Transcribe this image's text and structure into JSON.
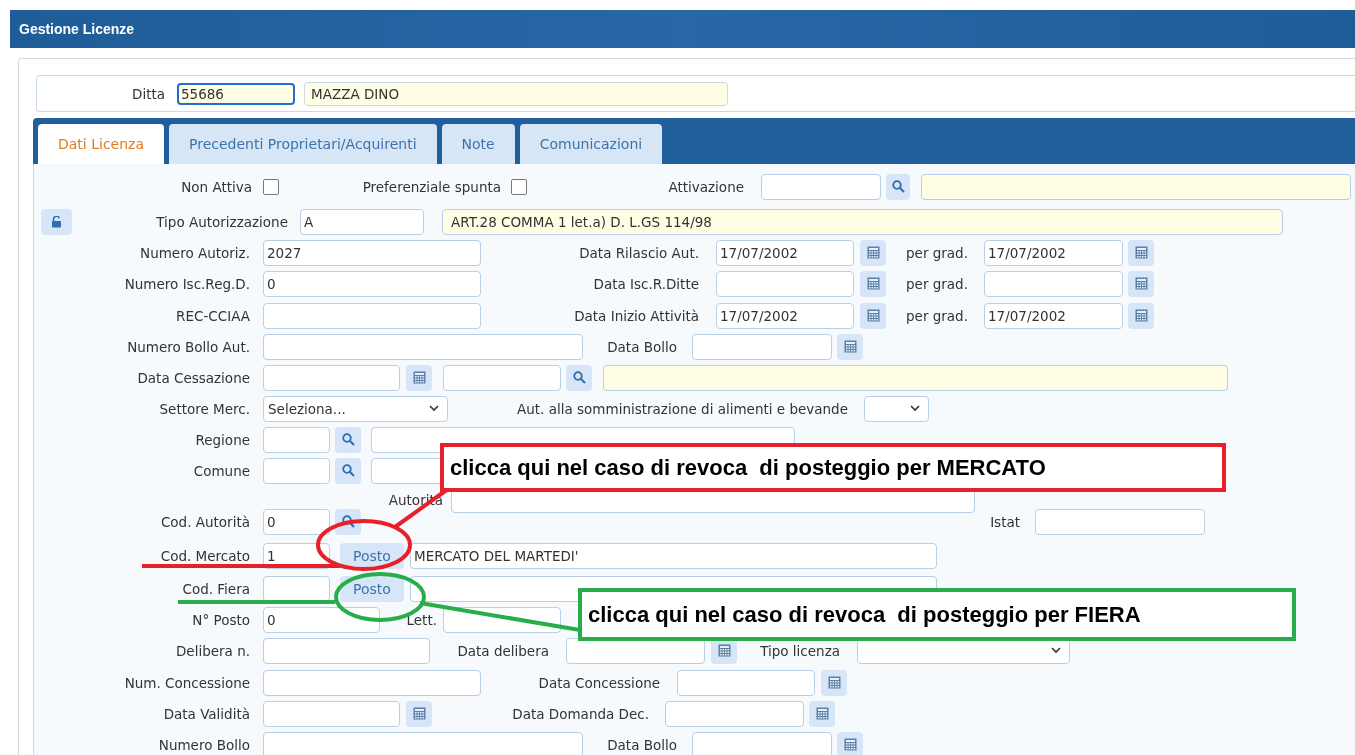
{
  "window": {
    "title": "Gestione Licenze"
  },
  "ditta": {
    "label": "Ditta",
    "code": "55686",
    "name": "MAZZA DINO"
  },
  "tabs": [
    {
      "label": "Dati Licenza",
      "selected": true
    },
    {
      "label": "Precedenti Proprietari/Acquirenti",
      "selected": false
    },
    {
      "label": "Note",
      "selected": false
    },
    {
      "label": "Comunicazioni",
      "selected": false
    }
  ],
  "rows": [
    {
      "items": [
        {
          "kind": "label",
          "text": "Non Attiva"
        },
        {
          "kind": "checkbox",
          "checked": false
        },
        {
          "kind": "label",
          "text": "Preferenziale spunta"
        },
        {
          "kind": "checkbox",
          "checked": false
        },
        {
          "kind": "label",
          "text": "Attivazione"
        },
        {
          "kind": "input",
          "value": ""
        },
        {
          "kind": "search"
        },
        {
          "kind": "display",
          "value": ""
        }
      ]
    },
    {
      "items": [
        {
          "kind": "lock"
        },
        {
          "kind": "label",
          "text": "Tipo Autorizzazione"
        },
        {
          "kind": "input",
          "value": "A"
        },
        {
          "kind": "display",
          "value": "ART.28 COMMA 1 let.a) D. L.GS 114/98"
        }
      ]
    },
    {
      "items": [
        {
          "kind": "label",
          "text": "Numero Autoriz."
        },
        {
          "kind": "input",
          "value": "2027"
        },
        {
          "kind": "label",
          "text": "Data Rilascio Aut."
        },
        {
          "kind": "input",
          "value": "17/07/2002"
        },
        {
          "kind": "calendar"
        },
        {
          "kind": "label",
          "text": "per grad."
        },
        {
          "kind": "input",
          "value": "17/07/2002"
        },
        {
          "kind": "calendar"
        }
      ]
    },
    {
      "items": [
        {
          "kind": "label",
          "text": "Numero Isc.Reg.D."
        },
        {
          "kind": "input",
          "value": "0"
        },
        {
          "kind": "label",
          "text": "Data Isc.R.Ditte"
        },
        {
          "kind": "input",
          "value": ""
        },
        {
          "kind": "calendar"
        },
        {
          "kind": "label",
          "text": "per grad."
        },
        {
          "kind": "input",
          "value": ""
        },
        {
          "kind": "calendar"
        }
      ]
    },
    {
      "items": [
        {
          "kind": "label",
          "text": "REC-CCIAA"
        },
        {
          "kind": "input",
          "value": ""
        },
        {
          "kind": "label",
          "text": "Data Inizio Attività"
        },
        {
          "kind": "input",
          "value": "17/07/2002"
        },
        {
          "kind": "calendar"
        },
        {
          "kind": "label",
          "text": "per grad."
        },
        {
          "kind": "input",
          "value": "17/07/2002"
        },
        {
          "kind": "calendar"
        }
      ]
    },
    {
      "items": [
        {
          "kind": "label",
          "text": "Numero Bollo Aut."
        },
        {
          "kind": "input",
          "value": ""
        },
        {
          "kind": "label",
          "text": "Data Bollo"
        },
        {
          "kind": "input",
          "value": ""
        },
        {
          "kind": "calendar"
        }
      ]
    },
    {
      "items": [
        {
          "kind": "label",
          "text": "Data Cessazione"
        },
        {
          "kind": "input",
          "value": ""
        },
        {
          "kind": "calendar"
        },
        {
          "kind": "input",
          "value": ""
        },
        {
          "kind": "search"
        },
        {
          "kind": "display",
          "value": ""
        }
      ]
    },
    {
      "items": [
        {
          "kind": "label",
          "text": "Settore Merc."
        },
        {
          "kind": "select",
          "value": "Seleziona..."
        },
        {
          "kind": "label",
          "text": "Aut. alla somministrazione di alimenti e bevande"
        },
        {
          "kind": "select",
          "value": ""
        }
      ]
    },
    {
      "items": [
        {
          "kind": "label",
          "text": "Regione"
        },
        {
          "kind": "input",
          "value": ""
        },
        {
          "kind": "search"
        },
        {
          "kind": "input",
          "value": ""
        }
      ]
    },
    {
      "items": [
        {
          "kind": "label",
          "text": "Comune"
        },
        {
          "kind": "input",
          "value": ""
        },
        {
          "kind": "search"
        },
        {
          "kind": "input",
          "value": ""
        }
      ]
    },
    {
      "items": [
        {
          "kind": "label",
          "text": "Autorita"
        },
        {
          "kind": "input",
          "value": ""
        }
      ]
    },
    {
      "items": [
        {
          "kind": "label",
          "text": "Cod. Autorità"
        },
        {
          "kind": "input",
          "value": "0"
        },
        {
          "kind": "search"
        },
        {
          "kind": "label",
          "text": "Istat"
        },
        {
          "kind": "input",
          "value": ""
        }
      ]
    },
    {
      "items": [
        {
          "kind": "label",
          "text": "Cod. Mercato"
        },
        {
          "kind": "input",
          "value": "1"
        },
        {
          "kind": "button",
          "text": "Posto"
        },
        {
          "kind": "input",
          "value": "MERCATO DEL MARTEDI'"
        }
      ]
    },
    {
      "items": [
        {
          "kind": "label",
          "text": "Cod. Fiera"
        },
        {
          "kind": "input",
          "value": ""
        },
        {
          "kind": "button",
          "text": "Posto"
        },
        {
          "kind": "input",
          "value": ""
        }
      ]
    },
    {
      "items": [
        {
          "kind": "label",
          "text": "N° Posto"
        },
        {
          "kind": "input",
          "value": "0"
        },
        {
          "kind": "label",
          "text": "Lett."
        },
        {
          "kind": "input",
          "value": ""
        }
      ]
    },
    {
      "items": [
        {
          "kind": "label",
          "text": "Delibera n."
        },
        {
          "kind": "input",
          "value": ""
        },
        {
          "kind": "label",
          "text": "Data delibera"
        },
        {
          "kind": "input",
          "value": ""
        },
        {
          "kind": "calendar"
        },
        {
          "kind": "label",
          "text": "Tipo licenza"
        },
        {
          "kind": "select",
          "value": ""
        }
      ]
    },
    {
      "items": [
        {
          "kind": "label",
          "text": "Num. Concessione"
        },
        {
          "kind": "input",
          "value": ""
        },
        {
          "kind": "label",
          "text": "Data Concessione"
        },
        {
          "kind": "input",
          "value": ""
        },
        {
          "kind": "calendar"
        }
      ]
    },
    {
      "items": [
        {
          "kind": "label",
          "text": "Data Validità"
        },
        {
          "kind": "input",
          "value": ""
        },
        {
          "kind": "calendar"
        },
        {
          "kind": "label",
          "text": "Data Domanda Dec."
        },
        {
          "kind": "input",
          "value": ""
        },
        {
          "kind": "calendar"
        }
      ]
    },
    {
      "items": [
        {
          "kind": "label",
          "text": "Numero Bollo"
        },
        {
          "kind": "input",
          "value": ""
        },
        {
          "kind": "label",
          "text": "Data Bollo"
        },
        {
          "kind": "input",
          "value": ""
        },
        {
          "kind": "calendar"
        }
      ]
    }
  ],
  "annotations": [
    {
      "text": "clicca qui nel caso di revoca  di posteggio per MERCATO",
      "color": "#e8202a"
    },
    {
      "text": "clicca qui nel caso di revoca  di posteggio per FIERA",
      "color": "#27ae4a"
    }
  ]
}
